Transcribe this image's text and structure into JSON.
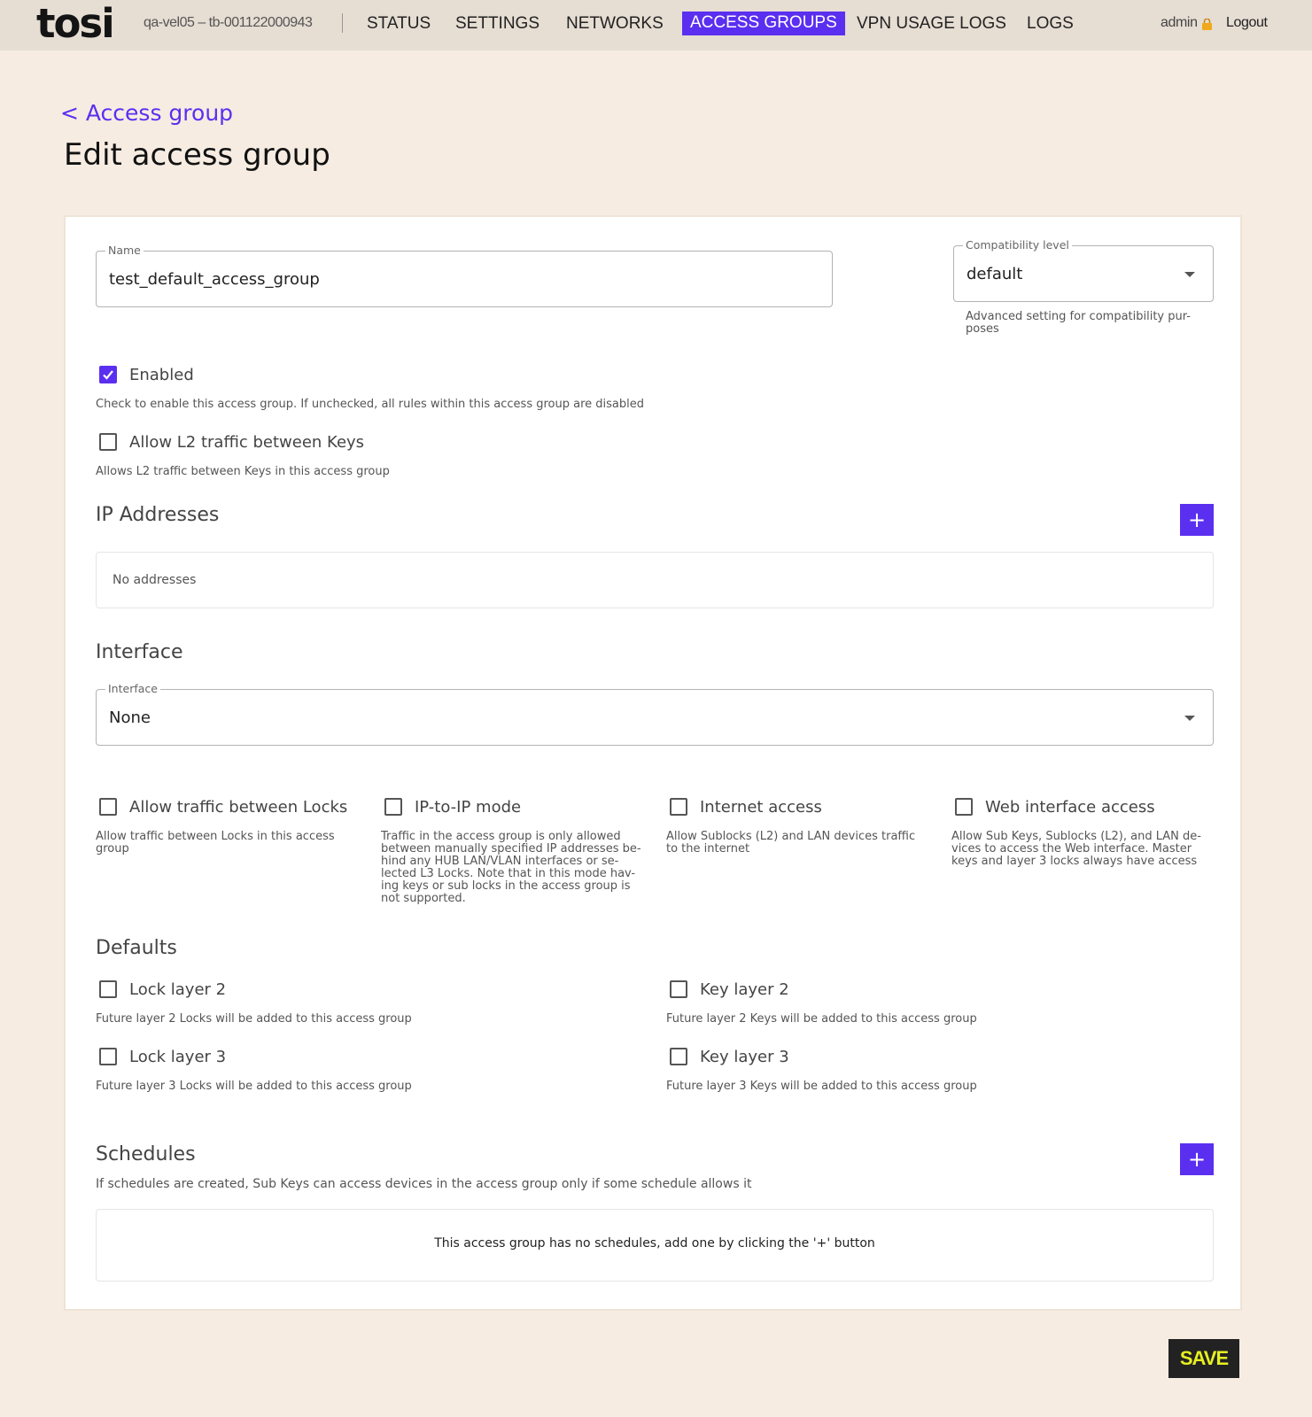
{
  "nav": {
    "logo": "tosi",
    "device": "qa-vel05 – tb-001122000943",
    "links": [
      "STATUS",
      "SETTINGS",
      "NETWORKS",
      "ACCESS GROUPS",
      "VPN USAGE LOGS",
      "LOGS"
    ],
    "active": "ACCESS GROUPS",
    "user": "admin",
    "logout": "Logout"
  },
  "header": {
    "back": "< Access group",
    "title": "Edit access group"
  },
  "form": {
    "name": {
      "label": "Name",
      "value": "test_default_access_group"
    },
    "compatibility": {
      "label": "Compatibility level",
      "value": "default",
      "helper": "Advanced setting for compatibility pur-\nposes"
    },
    "enabled": {
      "label": "Enabled",
      "checked": true,
      "desc": "Check to enable this access group. If unchecked, all rules within this access group are disabled"
    },
    "allow_l2": {
      "label": "Allow L2 traffic between Keys",
      "checked": false,
      "desc": "Allows L2 traffic between Keys in this access group"
    },
    "ip_section": {
      "title": "IP Addresses",
      "empty": "No addresses"
    },
    "interface_section": {
      "title": "Interface",
      "field_label": "Interface",
      "value": "None"
    },
    "options": [
      {
        "label": "Allow traffic between Locks",
        "checked": false,
        "desc": "Allow traffic between Locks in this access\ngroup"
      },
      {
        "label": "IP-to-IP mode",
        "checked": false,
        "desc": "Traffic in the access group is only allowed\nbetween manually specified IP addresses be-\nhind any HUB LAN/VLAN interfaces or se-\nlected L3 Locks. Note that in this mode hav-\ning keys or sub locks in the access group is\nnot supported."
      },
      {
        "label": "Internet access",
        "checked": false,
        "desc": "Allow Sublocks (L2) and LAN devices traffic\nto the internet"
      },
      {
        "label": "Web interface access",
        "checked": false,
        "desc": "Allow Sub Keys, Sublocks (L2), and LAN de-\nvices to access the Web interface. Master\nkeys and layer 3 locks always have access"
      }
    ],
    "defaults": {
      "title": "Defaults",
      "items": [
        {
          "label": "Lock layer 2",
          "checked": false,
          "desc": "Future layer 2 Locks will be added to this access group"
        },
        {
          "label": "Key layer 2",
          "checked": false,
          "desc": "Future layer 2 Keys will be added to this access group"
        },
        {
          "label": "Lock layer 3",
          "checked": false,
          "desc": "Future layer 3 Locks will be added to this access group"
        },
        {
          "label": "Key layer 3",
          "checked": false,
          "desc": "Future layer 3 Keys will be added to this access group"
        }
      ]
    },
    "schedules": {
      "title": "Schedules",
      "desc": "If schedules are created, Sub Keys can access devices in the access group only if some schedule allows it",
      "empty": "This access group has no schedules, add one by clicking the '+' button"
    },
    "add_label": "+",
    "save": "SAVE"
  },
  "colors": {
    "accent": "#5b2ff0",
    "background": "#f6ece2",
    "topbar": "#e6ddd3",
    "save_text": "#e6f021"
  },
  "icons": [
    "lock-icon",
    "check-icon",
    "chevron-down-icon",
    "plus-icon"
  ]
}
